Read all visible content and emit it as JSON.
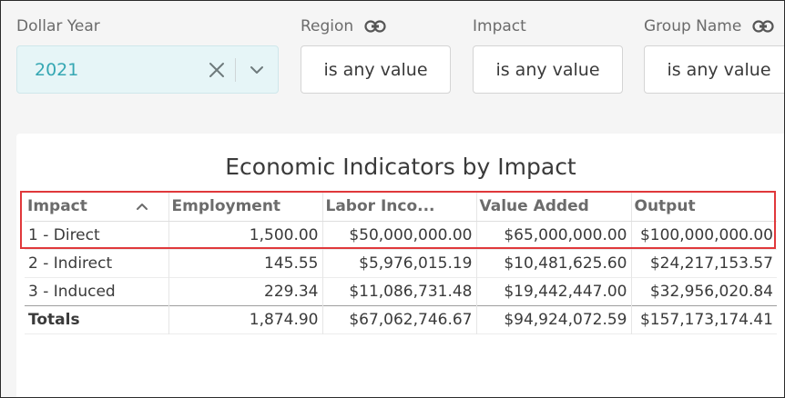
{
  "filters": {
    "dollar_year": {
      "label": "Dollar Year",
      "value": "2021"
    },
    "region": {
      "label": "Region",
      "value": "is any value"
    },
    "impact": {
      "label": "Impact",
      "value": "is any value"
    },
    "group_name": {
      "label": "Group Name",
      "value": "is any value"
    }
  },
  "table": {
    "title": "Economic Indicators by Impact",
    "columns": [
      "Impact",
      "Employment",
      "Labor Inco...",
      "Value Added",
      "Output"
    ],
    "sorted_column": "Impact",
    "sort_direction": "ascending",
    "rows": [
      [
        "1 - Direct",
        "1,500.00",
        "$50,000,000.00",
        "$65,000,000.00",
        "$100,000,000.00"
      ],
      [
        "2 - Indirect",
        "145.55",
        "$5,976,015.19",
        "$10,481,625.60",
        "$24,217,153.57"
      ],
      [
        "3 - Induced",
        "229.34",
        "$11,086,731.48",
        "$19,442,447.00",
        "$32,956,020.84"
      ]
    ],
    "totals": [
      "Totals",
      "1,874.90",
      "$67,062,746.67",
      "$94,924,072.59",
      "$157,173,174.41"
    ]
  },
  "colors": {
    "accent": "#35a7b3",
    "highlight": "#e0383b"
  },
  "icons": {
    "link": "link-icon",
    "clear": "close-icon",
    "dropdown": "chevron-down-icon",
    "sort": "chevron-up-icon"
  }
}
